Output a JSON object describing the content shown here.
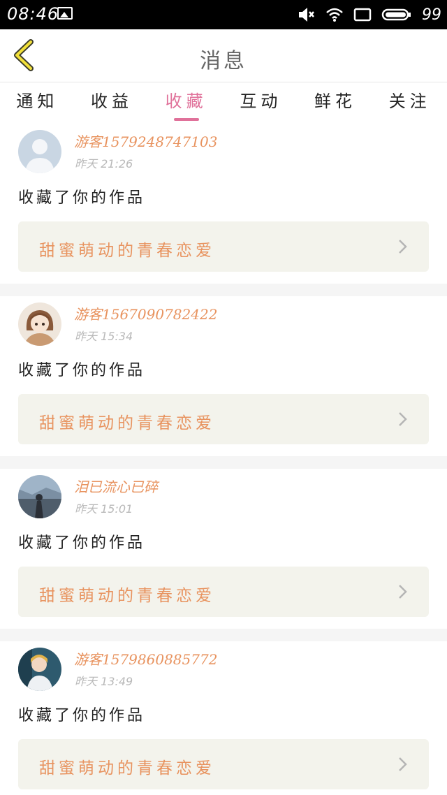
{
  "status_bar": {
    "time": "08:46",
    "battery": "99"
  },
  "header": {
    "title": "消息"
  },
  "tabs": [
    {
      "label": "通知"
    },
    {
      "label": "收益"
    },
    {
      "label": "收藏",
      "active": true
    },
    {
      "label": "互动"
    },
    {
      "label": "鲜花"
    },
    {
      "label": "关注"
    }
  ],
  "messages": [
    {
      "user": "游客1579248747103",
      "time": "昨天 21:26",
      "action": "收藏了你的作品",
      "work": "甜蜜萌动的青春恋爱"
    },
    {
      "user": "游客1567090782422",
      "time": "昨天 15:34",
      "action": "收藏了你的作品",
      "work": "甜蜜萌动的青春恋爱"
    },
    {
      "user": "泪已流心已碎",
      "time": "昨天 15:01",
      "action": "收藏了你的作品",
      "work": "甜蜜萌动的青春恋爱"
    },
    {
      "user": "游客1579860885772",
      "time": "昨天 13:49",
      "action": "收藏了你的作品",
      "work": "甜蜜萌动的青春恋爱"
    }
  ],
  "colors": {
    "accent": "#e0719a",
    "username": "#e8935f",
    "card_bg": "#f3f3ec"
  }
}
